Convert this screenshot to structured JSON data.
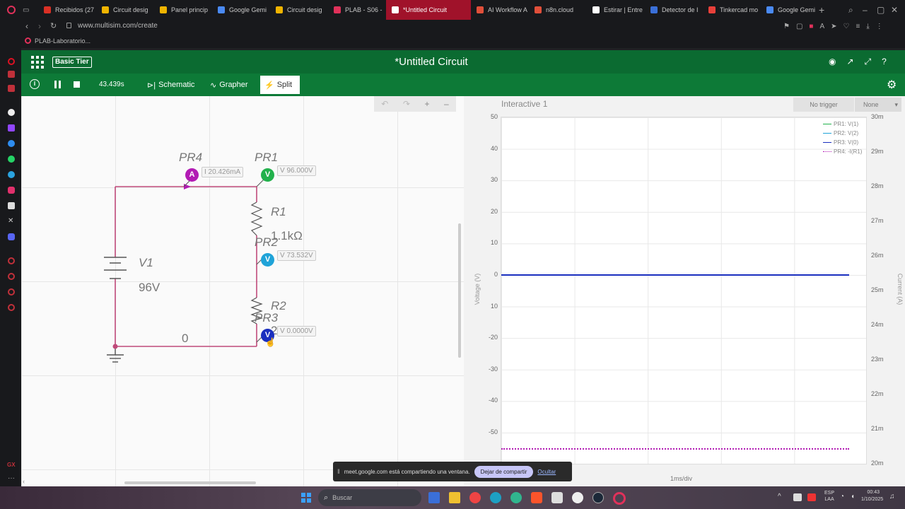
{
  "browser": {
    "tabs": [
      {
        "label": "Recibidos (27",
        "color": "#d93025"
      },
      {
        "label": "Circuit desig",
        "color": "#f0b400"
      },
      {
        "label": "Panel princip",
        "color": "#f0b400"
      },
      {
        "label": "Google Gemi",
        "color": "#4a8af4"
      },
      {
        "label": "Circuit desig",
        "color": "#f0b400"
      },
      {
        "label": "PLAB - S06 -",
        "color": "#e0315a"
      },
      {
        "label": "*Untitled Circuit",
        "color": "#ffffff"
      },
      {
        "label": "AI Workflow A",
        "color": "#e04f3a"
      },
      {
        "label": "n8n.cloud",
        "color": "#e04f3a"
      },
      {
        "label": "Estirar | Entre",
        "color": "#ffffff"
      },
      {
        "label": "Detector de I",
        "color": "#3a6fd8"
      },
      {
        "label": "Tinkercad mo",
        "color": "#e8403a"
      },
      {
        "label": "Google Gemi",
        "color": "#4a8af4"
      }
    ],
    "url": "www.multisim.com/create",
    "bookmark": "PLAB-Laboratorio..."
  },
  "app": {
    "tier_label": "Basic Tier",
    "title": "*Untitled Circuit",
    "sim_time": "43.439s",
    "tabs": {
      "schematic": "Schematic",
      "grapher": "Grapher",
      "split": "Split"
    }
  },
  "circuit": {
    "v1_name": "V1",
    "v1_value": "96V",
    "r1_name": "R1",
    "r1_value": "1.1kΩ",
    "r2_name": "R2",
    "r2_value_partial": "2",
    "node_zero": "0",
    "probes": [
      {
        "name": "PR4",
        "type": "A",
        "reading": "I 20.426mA",
        "color": "#b21bb4"
      },
      {
        "name": "PR1",
        "type": "V",
        "reading": "V 96.000V",
        "color": "#22b14c"
      },
      {
        "name": "PR2",
        "type": "V",
        "reading": "V 73.532V",
        "color": "#1fa3d8"
      },
      {
        "name": "PR3",
        "type": "V",
        "reading": "V 0.0000V",
        "color": "#1a2fbf"
      }
    ]
  },
  "grapher": {
    "title": "Interactive 1",
    "trigger": "No trigger",
    "trigger_mode": "None",
    "y_left_label": "Voltage (V)",
    "y_right_label": "Current (A)",
    "x_label": "1ms/div",
    "y_left_ticks": [
      "50",
      "40",
      "30",
      "20",
      "10",
      "0",
      "10",
      "-20",
      "-30",
      "-40",
      "-50"
    ],
    "y_right_ticks": [
      "30m",
      "29m",
      "28m",
      "27m",
      "26m",
      "25m",
      "24m",
      "23m",
      "22m",
      "21m",
      "20m"
    ],
    "legend": [
      {
        "label": "PR1: V(1)",
        "color": "#22b14c"
      },
      {
        "label": "PR2: V(2)",
        "color": "#1fa3d8"
      },
      {
        "label": "PR3: V(0)",
        "color": "#1a2fbf"
      },
      {
        "label": "PR4: -I(R1)",
        "color": "#b21bb4"
      }
    ]
  },
  "notification": {
    "text": "meet.google.com está compartiendo una ventana.",
    "stop_button": "Dejar de compartir",
    "hide_link": "Ocultar"
  },
  "taskbar": {
    "search_placeholder": "Buscar",
    "lang": "ESP",
    "lang_sub": "LAA",
    "time": "00:43",
    "date": "1/10/2025"
  }
}
